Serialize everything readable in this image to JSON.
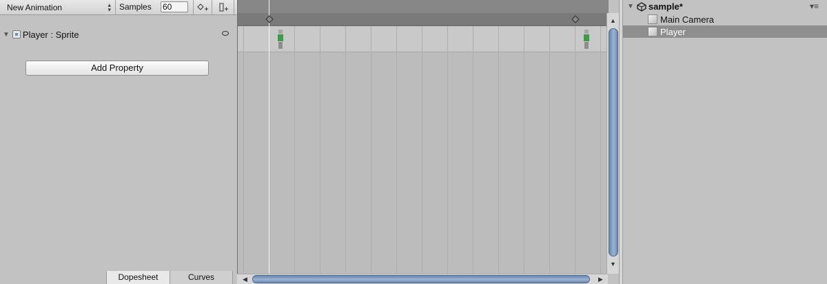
{
  "animation": {
    "clip_name": "New Animation",
    "samples_label": "Samples",
    "samples_value": "60",
    "add_keyframe_icon": "add-keyframe-icon",
    "add_event_icon": "add-event-icon"
  },
  "properties": [
    {
      "label": "Player : Sprite",
      "icon": "sprite-renderer-icon",
      "visibility_icon": "eye-icon"
    }
  ],
  "add_property_label": "Add Property",
  "view_tabs": [
    {
      "label": "Dopesheet",
      "active": true
    },
    {
      "label": "Curves",
      "active": false
    }
  ],
  "timeline": {
    "keyframes": 2,
    "scrollbar_arrows": {
      "up": "▲",
      "down": "▼",
      "left": "◀",
      "right": "▶"
    }
  },
  "hierarchy": {
    "scene_name": "sample*",
    "scene_icon": "unity-logo-icon",
    "menu_icon": "▾≡",
    "items": [
      {
        "label": "Main Camera",
        "selected": false
      },
      {
        "label": "Player",
        "selected": true
      }
    ]
  },
  "colors": {
    "selection": "#8e8e8e",
    "scroll_thumb": "#8ba5c8",
    "sprite_body": "#3d9a47"
  }
}
